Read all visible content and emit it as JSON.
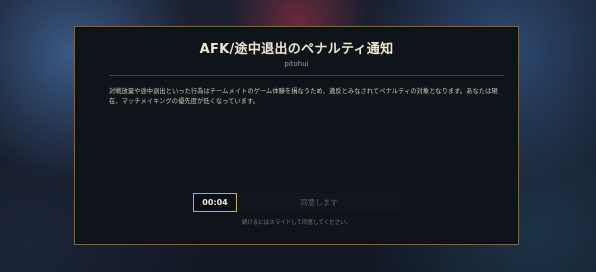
{
  "dialog": {
    "title": "AFK/途中退出のペナルティ通知",
    "player_name": "pitohui",
    "message": "対戦放棄や途中退出といった行為はチームメイトのゲーム体験を損なうため、違反とみなされてペナルティの対象となります。あなたは現在、マッチメイキングの優先度が低くなっています。",
    "timer": "00:04",
    "agree_label": "同意します",
    "hint": "続けるにはスライドして同意してください。"
  }
}
